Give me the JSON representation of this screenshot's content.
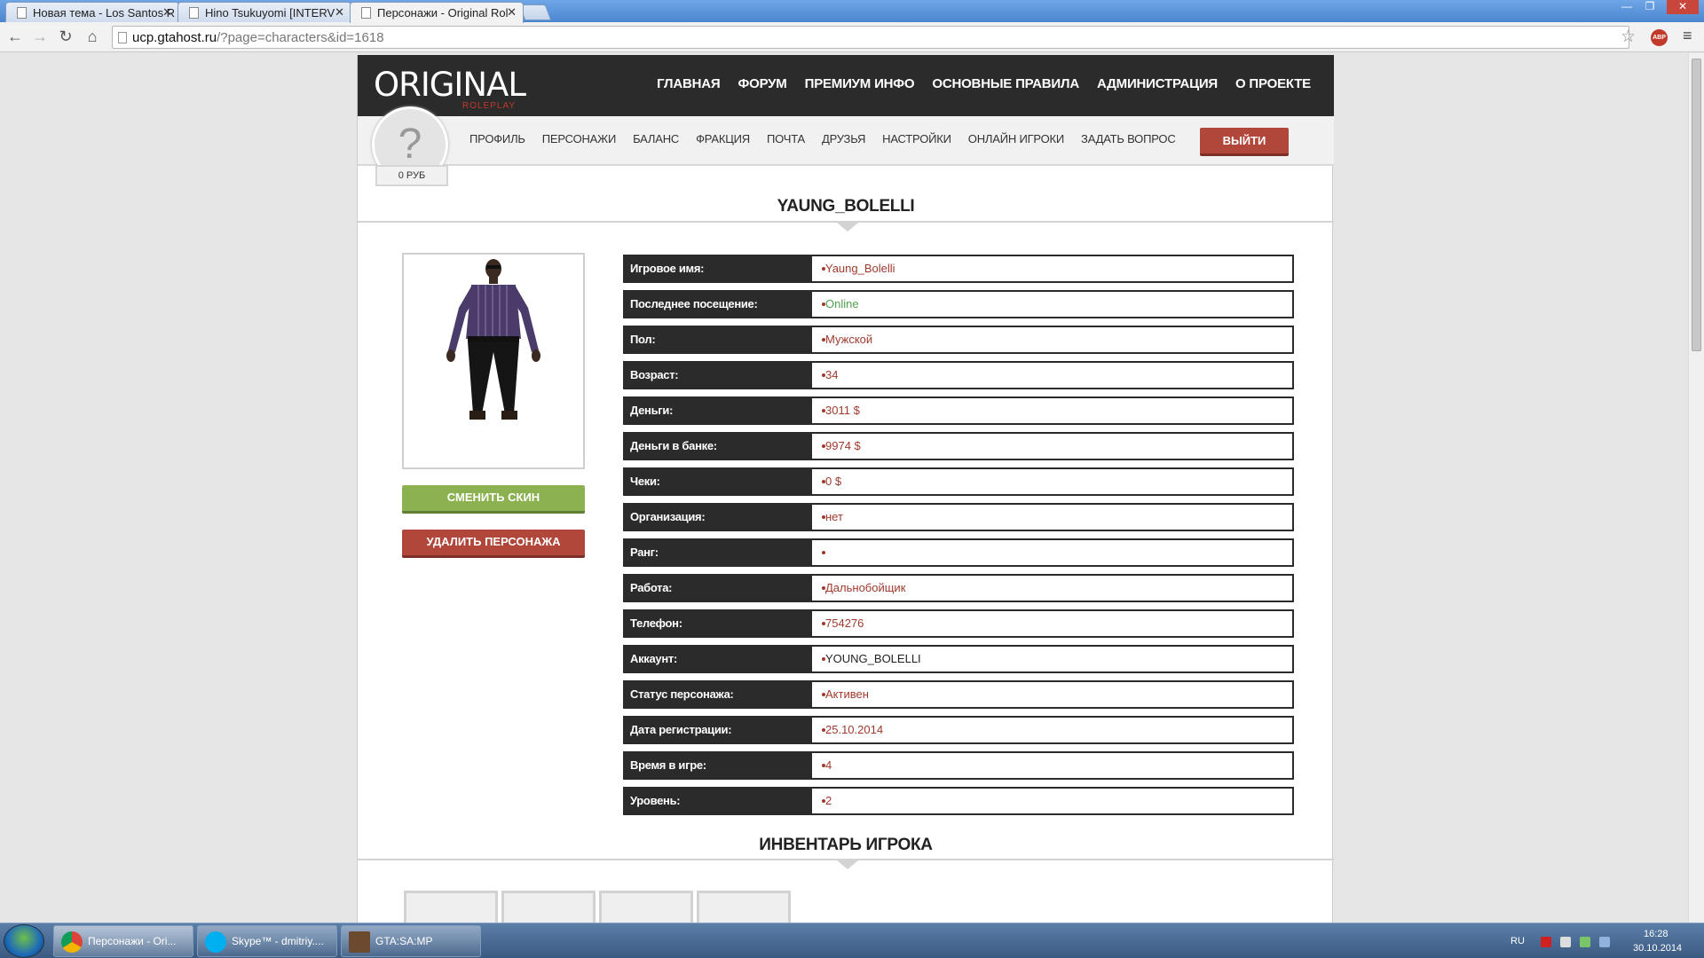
{
  "browser": {
    "tabs": [
      {
        "title": "Новая тема - Los Santos R"
      },
      {
        "title": "Hino Tsukuyomi [INTERV"
      },
      {
        "title": "Персонажи - Original Rol"
      }
    ],
    "url_host": "ucp.gtahost.ru",
    "url_rest": "/?page=characters&id=1618",
    "abp_label": "ABP"
  },
  "site": {
    "logo": "ORIGINAL",
    "logo_sub": "ROLEPLAY",
    "main_nav": [
      "ГЛАВНАЯ",
      "ФОРУМ",
      "ПРЕМИУМ ИНФО",
      "ОСНОВНЫЕ ПРАВИЛА",
      "АДМИНИСТРАЦИЯ",
      "О ПРОЕКТЕ"
    ],
    "avatar_glyph": "?",
    "balance": "0 РУБ",
    "sub_nav": [
      "ПРОФИЛЬ",
      "ПЕРСОНАЖИ",
      "БАЛАНС",
      "ФРАКЦИЯ",
      "ПОЧТА",
      "ДРУЗЬЯ",
      "НАСТРОЙКИ",
      "ОНЛАЙН ИГРОКИ",
      "ЗАДАТЬ ВОПРОС"
    ],
    "logout": "ВЫЙТИ"
  },
  "character": {
    "name": "YAUNG_BOLELLI",
    "change_skin": "СМЕНИТЬ СКИН",
    "delete": "УДАЛИТЬ ПЕРСОНАЖА",
    "fields": [
      {
        "label": "Игровое имя:",
        "value": "Yaung_Bolelli"
      },
      {
        "label": "Последнее посещение:",
        "value": "Online"
      },
      {
        "label": "Пол:",
        "value": "Мужской"
      },
      {
        "label": "Возраст:",
        "value": "34"
      },
      {
        "label": "Деньги:",
        "value": "3011 $"
      },
      {
        "label": "Деньги в банке:",
        "value": "9974 $"
      },
      {
        "label": "Чеки:",
        "value": "0 $"
      },
      {
        "label": "Организация:",
        "value": "нет"
      },
      {
        "label": "Ранг:",
        "value": ""
      },
      {
        "label": "Работа:",
        "value": "Дальнобойщик"
      },
      {
        "label": "Телефон:",
        "value": "754276"
      },
      {
        "label": "Аккаунт:",
        "value": "YOUNG_BOLELLI"
      },
      {
        "label": "Статус персонажа:",
        "value": "Активен"
      },
      {
        "label": "Дата регистрации:",
        "value": "25.10.2014"
      },
      {
        "label": "Время в игре:",
        "value": "4"
      },
      {
        "label": "Уровень:",
        "value": "2"
      }
    ],
    "inventory_title": "ИНВЕНТАРЬ ИГРОКА"
  },
  "taskbar": {
    "items": [
      "Персонажи - Ori...",
      "Skype™ - dmitriy....",
      "GTA:SA:MP"
    ],
    "lang": "RU",
    "time": "16:28",
    "date": "30.10.2014"
  },
  "colors": {
    "accent_red": "#b0473a",
    "accent_green": "#8bb150",
    "dark": "#2b2b2b"
  }
}
